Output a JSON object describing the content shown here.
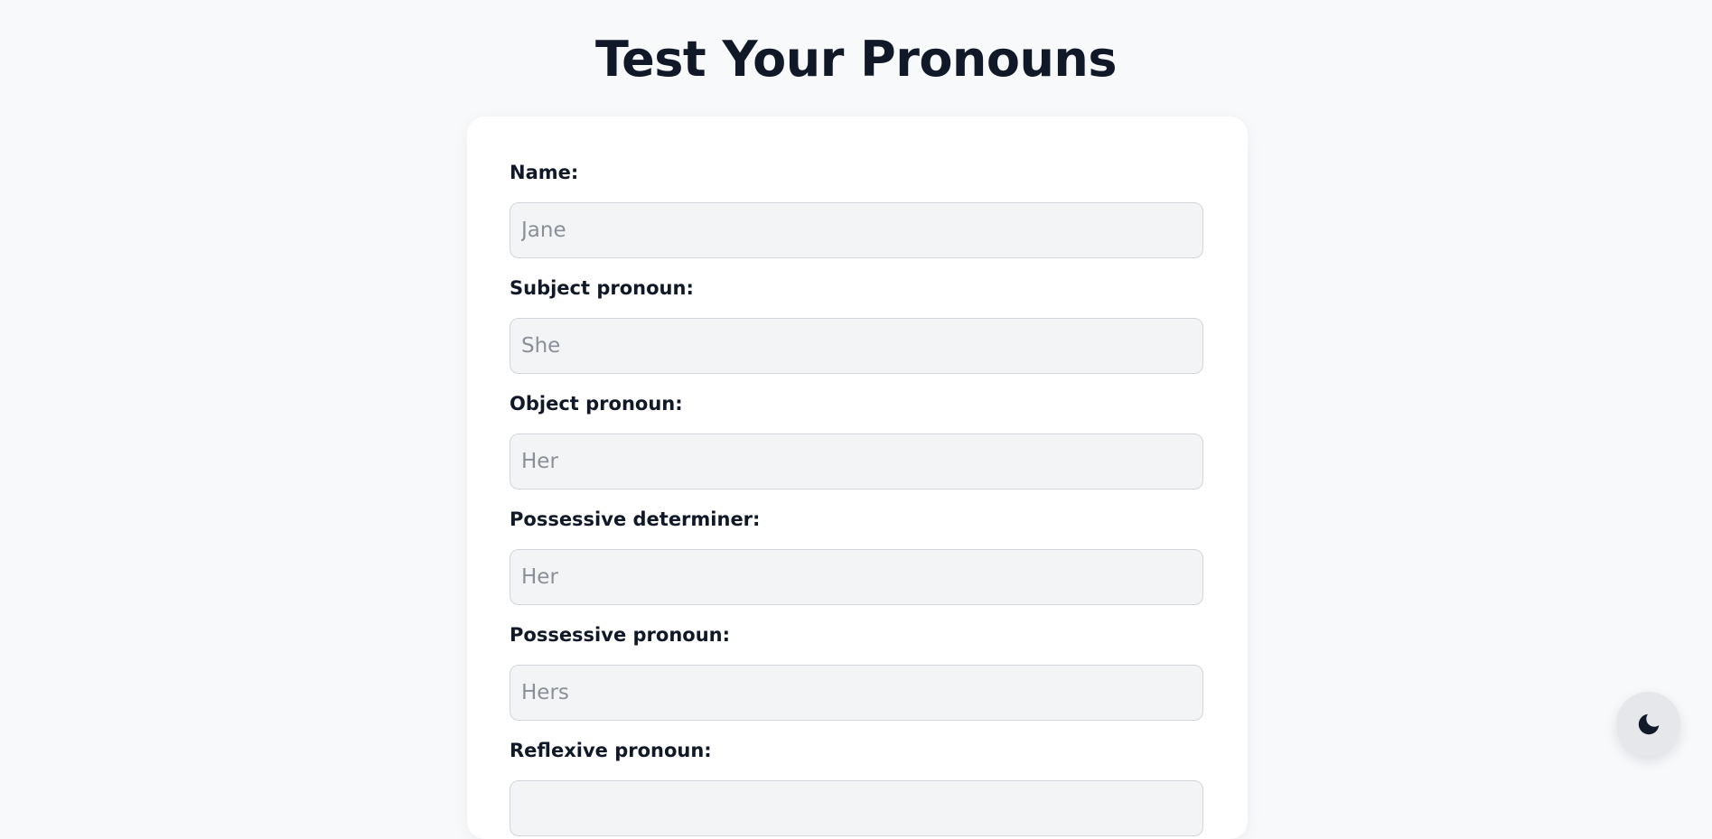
{
  "page": {
    "title": "Test Your Pronouns"
  },
  "form": {
    "fields": [
      {
        "label": "Name:",
        "placeholder": "Jane"
      },
      {
        "label": "Subject pronoun:",
        "placeholder": "She"
      },
      {
        "label": "Object pronoun:",
        "placeholder": "Her"
      },
      {
        "label": "Possessive determiner:",
        "placeholder": "Her"
      },
      {
        "label": "Possessive pronoun:",
        "placeholder": "Hers"
      },
      {
        "label": "Reflexive pronoun:",
        "placeholder": ""
      }
    ]
  },
  "theme_toggle": {
    "icon": "moon-icon"
  },
  "colors": {
    "background": "#f8f9fb",
    "card": "#ffffff",
    "input_fill": "#f3f4f6",
    "input_border": "#d1d5db",
    "text": "#111827",
    "placeholder": "#8a8f98",
    "toggle": "#e5e7eb"
  }
}
